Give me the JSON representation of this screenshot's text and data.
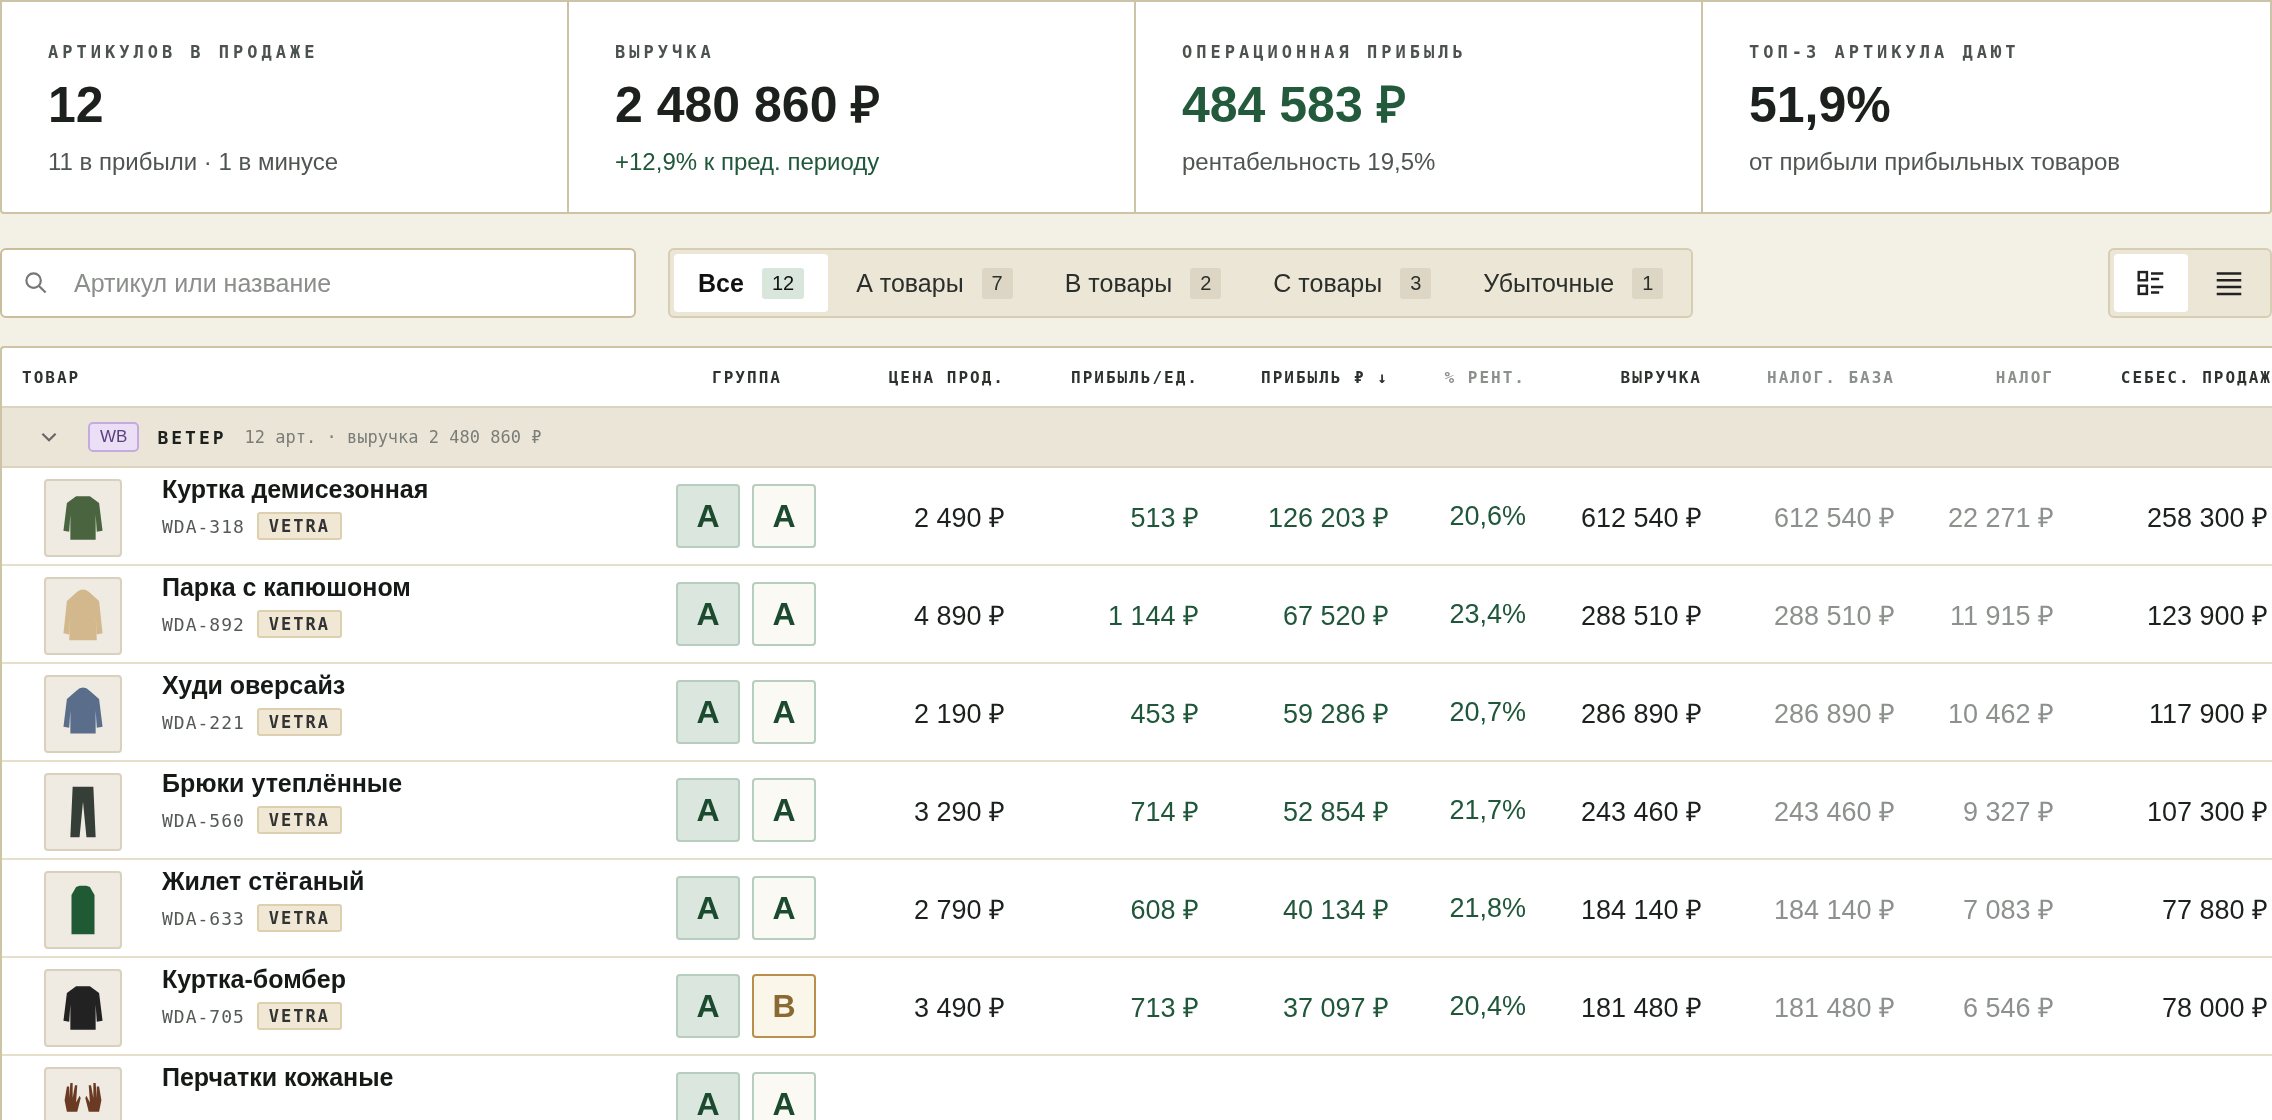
{
  "summary_cards": [
    {
      "label": "АРТИКУЛОВ В ПРОДАЖЕ",
      "value": "12",
      "note": "11 в прибыли · 1 в минусе",
      "highlight": false,
      "positive": false
    },
    {
      "label": "ВЫРУЧКА",
      "value": "2 480 860 ₽",
      "note": "+12,9% к пред. периоду",
      "highlight": false,
      "positive": true
    },
    {
      "label": "ОПЕРАЦИОННАЯ ПРИБЫЛЬ",
      "value": "484 583 ₽",
      "note": "рентабельность 19,5%",
      "highlight": true,
      "positive": false
    },
    {
      "label": "ТОП-3 АРТИКУЛА ДАЮТ",
      "value": "51,9%",
      "note": "от прибыли прибыльных товаров",
      "highlight": false,
      "positive": false
    }
  ],
  "search": {
    "placeholder": "Артикул или название"
  },
  "filter_tabs": [
    {
      "label": "Все",
      "count": "12",
      "selected": true
    },
    {
      "label": "А товары",
      "count": "7",
      "selected": false
    },
    {
      "label": "В товары",
      "count": "2",
      "selected": false
    },
    {
      "label": "С товары",
      "count": "3",
      "selected": false
    },
    {
      "label": "Убыточные",
      "count": "1",
      "selected": false
    }
  ],
  "view_toggle": [
    {
      "kind": "cards",
      "selected": true
    },
    {
      "kind": "list",
      "selected": false
    }
  ],
  "table": {
    "columns": [
      {
        "label": "ТОВАР",
        "muted": false
      },
      {
        "label": "ГРУППА",
        "muted": false
      },
      {
        "label": "ЦЕНА ПРОД.",
        "muted": false,
        "kind": "amount"
      },
      {
        "label": "ПРИБЫЛЬ/ЕД.",
        "muted": false,
        "kind": "profit"
      },
      {
        "label": "ПРИБЫЛЬ ₽ ↓",
        "muted": false,
        "kind": "profit"
      },
      {
        "label": "% РЕНТ.",
        "muted": true,
        "kind": "profit"
      },
      {
        "label": "ВЫРУЧКА",
        "muted": false,
        "kind": "amount"
      },
      {
        "label": "НАЛОГ. БАЗА",
        "muted": true,
        "kind": "tax"
      },
      {
        "label": "НАЛОГ",
        "muted": true,
        "kind": "tax"
      },
      {
        "label": "СЕБЕС. ПРОДАЖ",
        "muted": false,
        "kind": "amount"
      }
    ],
    "group": {
      "expanded": true,
      "marketplace": "WB",
      "name": "ВЕТЕР",
      "summary": "12 арт. · выручка 2 480 860 ₽"
    },
    "rows": [
      {
        "name": "Куртка демисезонная",
        "sku": "WDA-318",
        "brand": "VETRA",
        "kind": "jacket",
        "color": "#4a6440",
        "groups": [
          {
            "label": "А",
            "kind": "a",
            "filled": true
          },
          {
            "label": "А",
            "kind": "a",
            "filled": false
          }
        ],
        "values": [
          "2 490 ₽",
          "513 ₽",
          "126 203 ₽",
          "20,6%",
          "612 540 ₽",
          "612 540 ₽",
          "22 271 ₽",
          "258 300 ₽"
        ]
      },
      {
        "name": "Парка с капюшоном",
        "sku": "WDA-892",
        "brand": "VETRA",
        "kind": "parka",
        "color": "#d2b88c",
        "groups": [
          {
            "label": "А",
            "kind": "a",
            "filled": true
          },
          {
            "label": "А",
            "kind": "a",
            "filled": false
          }
        ],
        "values": [
          "4 890 ₽",
          "1 144 ₽",
          "67 520 ₽",
          "23,4%",
          "288 510 ₽",
          "288 510 ₽",
          "11 915 ₽",
          "123 900 ₽"
        ]
      },
      {
        "name": "Худи оверсайз",
        "sku": "WDA-221",
        "brand": "VETRA",
        "kind": "hoodie",
        "color": "#5a6e8c",
        "groups": [
          {
            "label": "А",
            "kind": "a",
            "filled": true
          },
          {
            "label": "А",
            "kind": "a",
            "filled": false
          }
        ],
        "values": [
          "2 190 ₽",
          "453 ₽",
          "59 286 ₽",
          "20,7%",
          "286 890 ₽",
          "286 890 ₽",
          "10 462 ₽",
          "117 900 ₽"
        ]
      },
      {
        "name": "Брюки утеплённые",
        "sku": "WDA-560",
        "brand": "VETRA",
        "kind": "pants",
        "color": "#363e38",
        "groups": [
          {
            "label": "А",
            "kind": "a",
            "filled": true
          },
          {
            "label": "А",
            "kind": "a",
            "filled": false
          }
        ],
        "values": [
          "3 290 ₽",
          "714 ₽",
          "52 854 ₽",
          "21,7%",
          "243 460 ₽",
          "243 460 ₽",
          "9 327 ₽",
          "107 300 ₽"
        ]
      },
      {
        "name": "Жилет стёганый",
        "sku": "WDA-633",
        "brand": "VETRA",
        "kind": "vest",
        "color": "#1f5a34",
        "groups": [
          {
            "label": "А",
            "kind": "a",
            "filled": true
          },
          {
            "label": "А",
            "kind": "a",
            "filled": false
          }
        ],
        "values": [
          "2 790 ₽",
          "608 ₽",
          "40 134 ₽",
          "21,8%",
          "184 140 ₽",
          "184 140 ₽",
          "7 083 ₽",
          "77 880 ₽"
        ]
      },
      {
        "name": "Куртка-бомбер",
        "sku": "WDA-705",
        "brand": "VETRA",
        "kind": "jacket",
        "color": "#222222",
        "groups": [
          {
            "label": "А",
            "kind": "a",
            "filled": true
          },
          {
            "label": "B",
            "kind": "b",
            "filled": false
          }
        ],
        "values": [
          "3 490 ₽",
          "713 ₽",
          "37 097 ₽",
          "20,4%",
          "181 480 ₽",
          "181 480 ₽",
          "6 546 ₽",
          "78 000 ₽"
        ]
      },
      {
        "name": "Перчатки кожаные",
        "kind": "gloves",
        "color": "#6b3a22",
        "groups": [
          {
            "label": "А",
            "kind": "a",
            "filled": true
          },
          {
            "label": "А",
            "kind": "a",
            "filled": false
          }
        ]
      }
    ]
  }
}
